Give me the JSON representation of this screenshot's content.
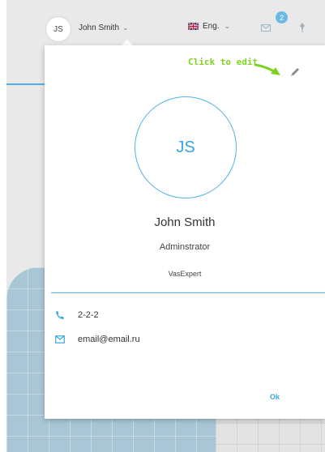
{
  "topbar": {
    "avatar_initials": "JS",
    "user_name": "John Smith",
    "language": "Eng.",
    "notification_count": "2"
  },
  "annotation": {
    "text": "Click to edit"
  },
  "profile": {
    "initials": "JS",
    "name": "John Smith",
    "role": "Adminstrator",
    "company": "VasExpert",
    "phone": "2-2-2",
    "email": "email@email.ru"
  },
  "actions": {
    "ok_label": "Ok"
  },
  "colors": {
    "accent": "#4fb3e8",
    "annotation_green": "#7ed321",
    "badge": "#6bb8e2"
  }
}
